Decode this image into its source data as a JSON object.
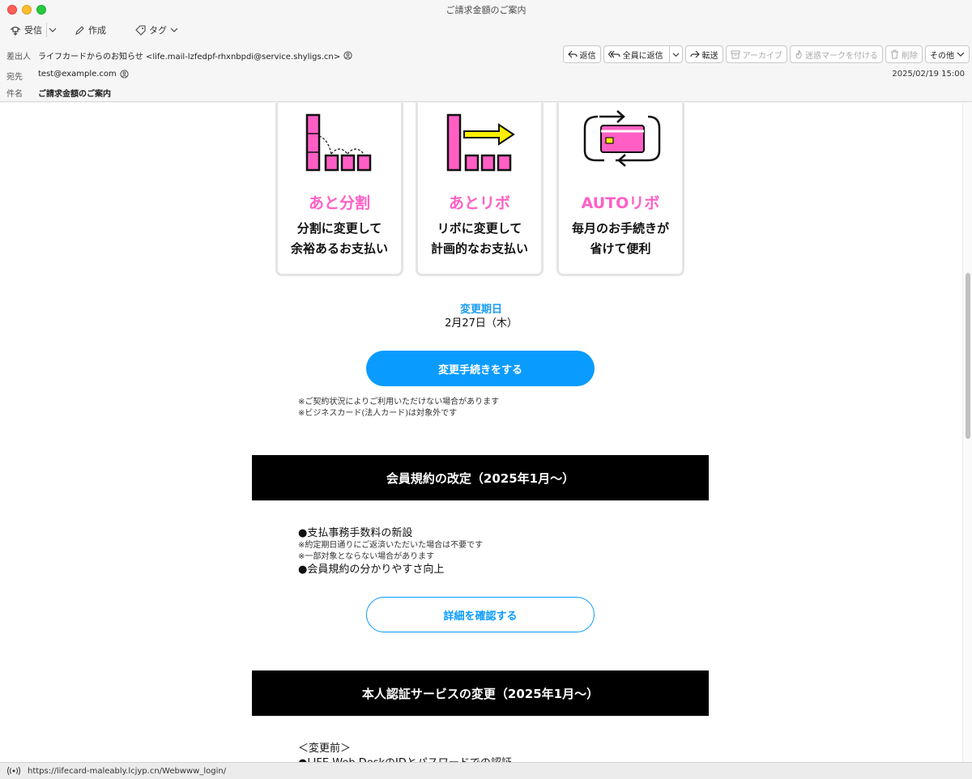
{
  "window": {
    "title": "ご請求金額のご案内"
  },
  "toolbar": {
    "receive": "受信",
    "compose": "作成",
    "tag": "タグ"
  },
  "header": {
    "from_label": "差出人",
    "from_value": "ライフカードからのお知らせ <life.mail-lzfedpf-rhxnbpdi@service.shyligs.cn>",
    "to_label": "宛先",
    "to_value": "test@example.com",
    "subject_label": "件名",
    "subject_value": "ご請求金額のご案内",
    "date": "2025/02/19 15:00",
    "actions": {
      "reply": "返信",
      "reply_all": "全員に返信",
      "forward": "転送",
      "archive": "アーカイブ",
      "spam": "迷惑マークを付ける",
      "delete": "削除",
      "other": "その他"
    }
  },
  "cards": [
    {
      "title": "あと分割",
      "line1": "分割に変更して",
      "line2": "余裕あるお支払い",
      "icon": "installment-icon"
    },
    {
      "title": "あとリボ",
      "line1": "リボに変更して",
      "line2": "計画的なお支払い",
      "icon": "revolving-icon"
    },
    {
      "title": "AUTOリボ",
      "line1": "毎月のお手続きが",
      "line2": "省けて便利",
      "icon": "auto-card-icon"
    }
  ],
  "change": {
    "label": "変更期日",
    "date": "2月27日（木）",
    "button": "変更手続きをする",
    "note1": "※ご契約状況によりご利用いただけない場合があります",
    "note2": "※ビジネスカード(法人カード)は対象外です"
  },
  "section1": {
    "title": "会員規約の改定（2025年1月〜）",
    "bullet1": "●支払事務手数料の新設",
    "note1": "※約定期日通りにご返済いただいた場合は不要です",
    "note2": "※一部対象とならない場合があります",
    "bullet2": "●会員規約の分かりやすさ向上",
    "button": "詳細を確認する"
  },
  "section2": {
    "title": "本人認証サービスの変更（2025年1月〜）",
    "before": "＜変更前＞",
    "bullet1": "●LIFE-Web DeskのIDとパスワードでの認証"
  },
  "status": {
    "url": "https://lifecard-maleably.lcjyp.cn/Webwww_login/"
  },
  "colors": {
    "pink": "#ff5fc5",
    "blue": "#0a9bff",
    "yellow": "#ffee00"
  }
}
